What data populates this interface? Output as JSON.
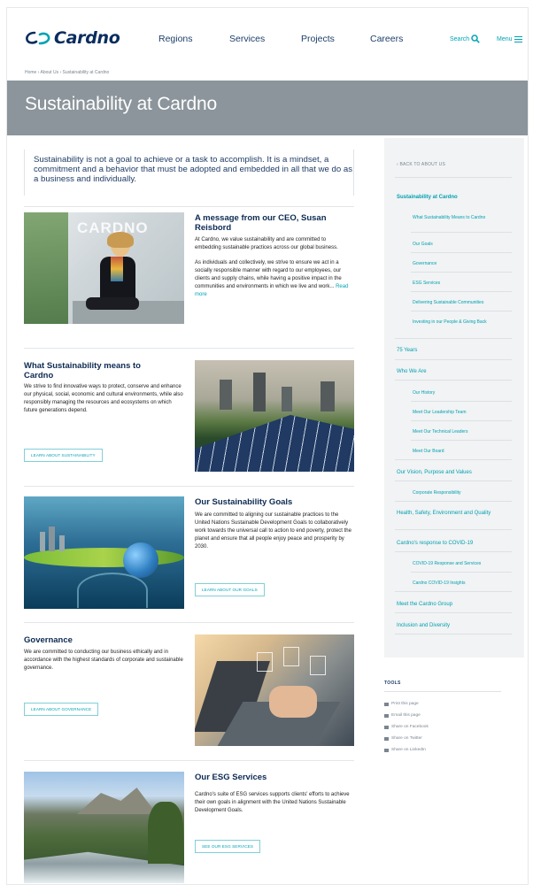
{
  "header": {
    "logo": "Cardno",
    "nav": [
      "Regions",
      "Services",
      "Projects",
      "Careers"
    ],
    "search_label": "Search",
    "menu_label": "Menu"
  },
  "breadcrumb": "Home  ›  About Us  ›  Sustainability at Cardno",
  "hero_title": "Sustainability at Cardno",
  "intro": "Sustainability is not a goal to achieve or a task to accomplish. It is a mindset, a commitment and a behavior that must be adopted and embedded in all that we do as a business and individually.",
  "blocks": [
    {
      "title": "A message from our CEO, Susan Reisbord",
      "text1": "At Cardno, we value sustainability and are committed to embedding sustainable practices across our global business.",
      "text2": "As individuals and collectively, we strive to ensure we act in a socially responsible manner with regard to our employees, our clients and supply chains, while having a positive impact in the communities and environments in which we live and work...",
      "link": "Read more",
      "image_text": "CARDNO"
    },
    {
      "title": "What Sustainability means to Cardno",
      "text": "We strive to find innovative ways to protect, conserve and enhance our physical, social, economic and cultural environments, while also responsibly managing the resources and ecosystems on which future generations depend.",
      "button": "LEARN ABOUT SUSTAINABILITY"
    },
    {
      "title": "Our Sustainability Goals",
      "text": "We are committed to aligning our sustainable practices to the United Nations Sustainable Development Goals to collaboratively work towards the universal call to action to end poverty, protect the planet and ensure that all people enjoy peace and prosperity by 2030.",
      "button": "LEARN ABOUT OUR GOALS"
    },
    {
      "title": "Governance",
      "text": "We are committed to conducting our business ethically and in accordance with the highest standards of corporate and sustainable governance.",
      "button": "LEARN ABOUT GOVERNANCE"
    },
    {
      "title": "Our ESG Services",
      "text": "Cardno's suite of ESG services supports clients' efforts to achieve their own goals in alignment with the United Nations Sustainable Development Goals.",
      "button": "SEE OUR ESG SERVICES"
    }
  ],
  "sidebar": {
    "back": "‹ BACK TO ABOUT US",
    "items": [
      {
        "label": "Sustainability at Cardno"
      },
      {
        "label": "What Sustainability Means to Cardno"
      },
      {
        "label": "Our Goals"
      },
      {
        "label": "Governance"
      },
      {
        "label": "ESG Services"
      },
      {
        "label": "Delivering Sustainable Communities"
      },
      {
        "label": "Investing in our People & Giving Back"
      },
      {
        "label": "75 Years"
      },
      {
        "label": "Who We Are"
      },
      {
        "label": "Our History"
      },
      {
        "label": "Meet Our Leadership Team"
      },
      {
        "label": "Meet Our Technical Leaders"
      },
      {
        "label": "Meet Our Board"
      },
      {
        "label": "Our Vision, Purpose and Values"
      },
      {
        "label": "Corporate Responsibility"
      },
      {
        "label": "Health, Safety, Environment and Quality"
      },
      {
        "label": "Cardno's response to COVID-19"
      },
      {
        "label": "COVID-19 Response and Services"
      },
      {
        "label": "Cardno COVID-19 Insights"
      },
      {
        "label": "Meet the Cardno Group"
      },
      {
        "label": "Inclusion and Diversity"
      }
    ]
  },
  "tools": {
    "title": "TOOLS",
    "items": [
      "Print this page",
      "Email this page",
      "Share on Facebook",
      "Share on Twitter",
      "Share on LinkedIn"
    ]
  },
  "colors": {
    "accent": "#00a3b4",
    "navy": "#0c2a52",
    "hero": "#8b959b"
  }
}
